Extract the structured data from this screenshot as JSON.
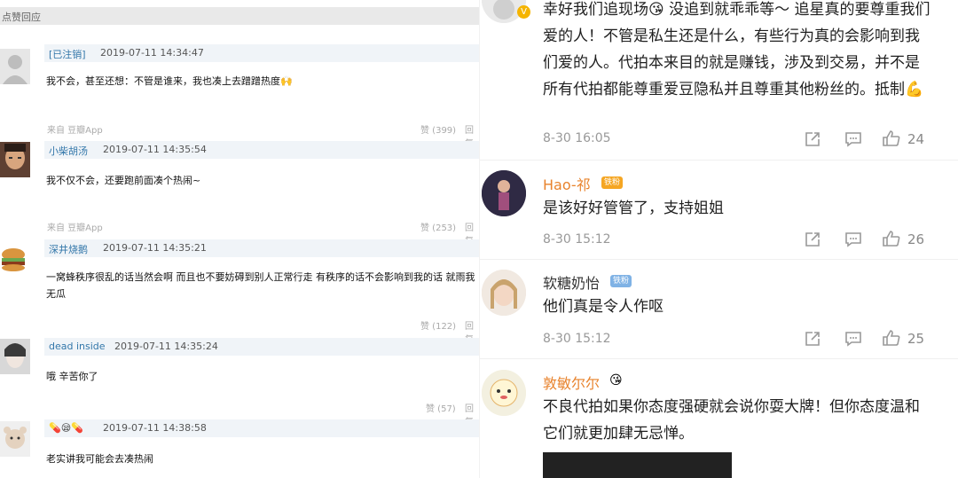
{
  "left": {
    "header": "点赞回应",
    "comments": [
      {
        "name": "[已注销]",
        "time": "2019-07-11 14:34:47",
        "text": "我不会，甚至还想：不管是谁来，我也凑上去蹭蹭热度🙌",
        "source": "来自 豆瓣App",
        "likes": "赞 (399)",
        "reply": "回复"
      },
      {
        "name": "小柴胡汤",
        "time": "2019-07-11 14:35:54",
        "text": "我不仅不会，还要跑前面凑个热闹~",
        "source": "来自 豆瓣App",
        "likes": "赞 (253)",
        "reply": "回复"
      },
      {
        "name": "深井烧鹅",
        "time": "2019-07-11 14:35:21",
        "text": "一窝蜂秩序很乱的话当然会啊 而且也不要妨碍到别人正常行走 有秩序的话不会影响到我的话 就雨我无瓜",
        "source": "",
        "likes": "赞 (122)",
        "reply": "回复"
      },
      {
        "name": "dead inside",
        "time": "2019-07-11 14:35:24",
        "text": "哦 辛苦你了",
        "source": "",
        "likes": "赞 (57)",
        "reply": "回复"
      },
      {
        "name": "💊😪💊",
        "time": "2019-07-11 14:38:58",
        "text": "老实讲我可能会去凑热闹",
        "source": "",
        "likes": "",
        "reply": ""
      }
    ]
  },
  "right": {
    "comments": [
      {
        "name": "",
        "badge": "",
        "text": "幸好我们追现场😘 没追到就乖乖等～ 追星真的要尊重我们爱的人！不管是私生还是什么，有些行为真的会影响到我们爱的人。代拍本来目的就是赚钱，涉及到交易，并不是所有代拍都能尊重爱豆隐私并且尊重其他粉丝的。抵制💪",
        "time": "8-30 16:05",
        "likes": "24"
      },
      {
        "name": "Hao-祁",
        "badge": "铁粉",
        "text": "是该好好管管了，支持姐姐",
        "time": "8-30 15:12",
        "likes": "26"
      },
      {
        "name": "软糖奶怡",
        "badge": "铁粉",
        "text": "他们真是令人作呕",
        "time": "8-30 15:12",
        "likes": "25"
      },
      {
        "name": "敦敏尔尔",
        "badge": "",
        "text": "不良代拍如果你态度强硬就会说你耍大牌！但你态度温和它们就更加肆无忌惮。",
        "time": "",
        "likes": ""
      }
    ]
  },
  "colors": {
    "douban_link": "#3377aa",
    "weibo_name": "#e8832d",
    "meta_bg": "#f0f4f8"
  },
  "icons": [
    "share-icon",
    "comment-icon",
    "thumbs-up-icon",
    "v-verified-icon",
    "fan-badge-icon"
  ]
}
